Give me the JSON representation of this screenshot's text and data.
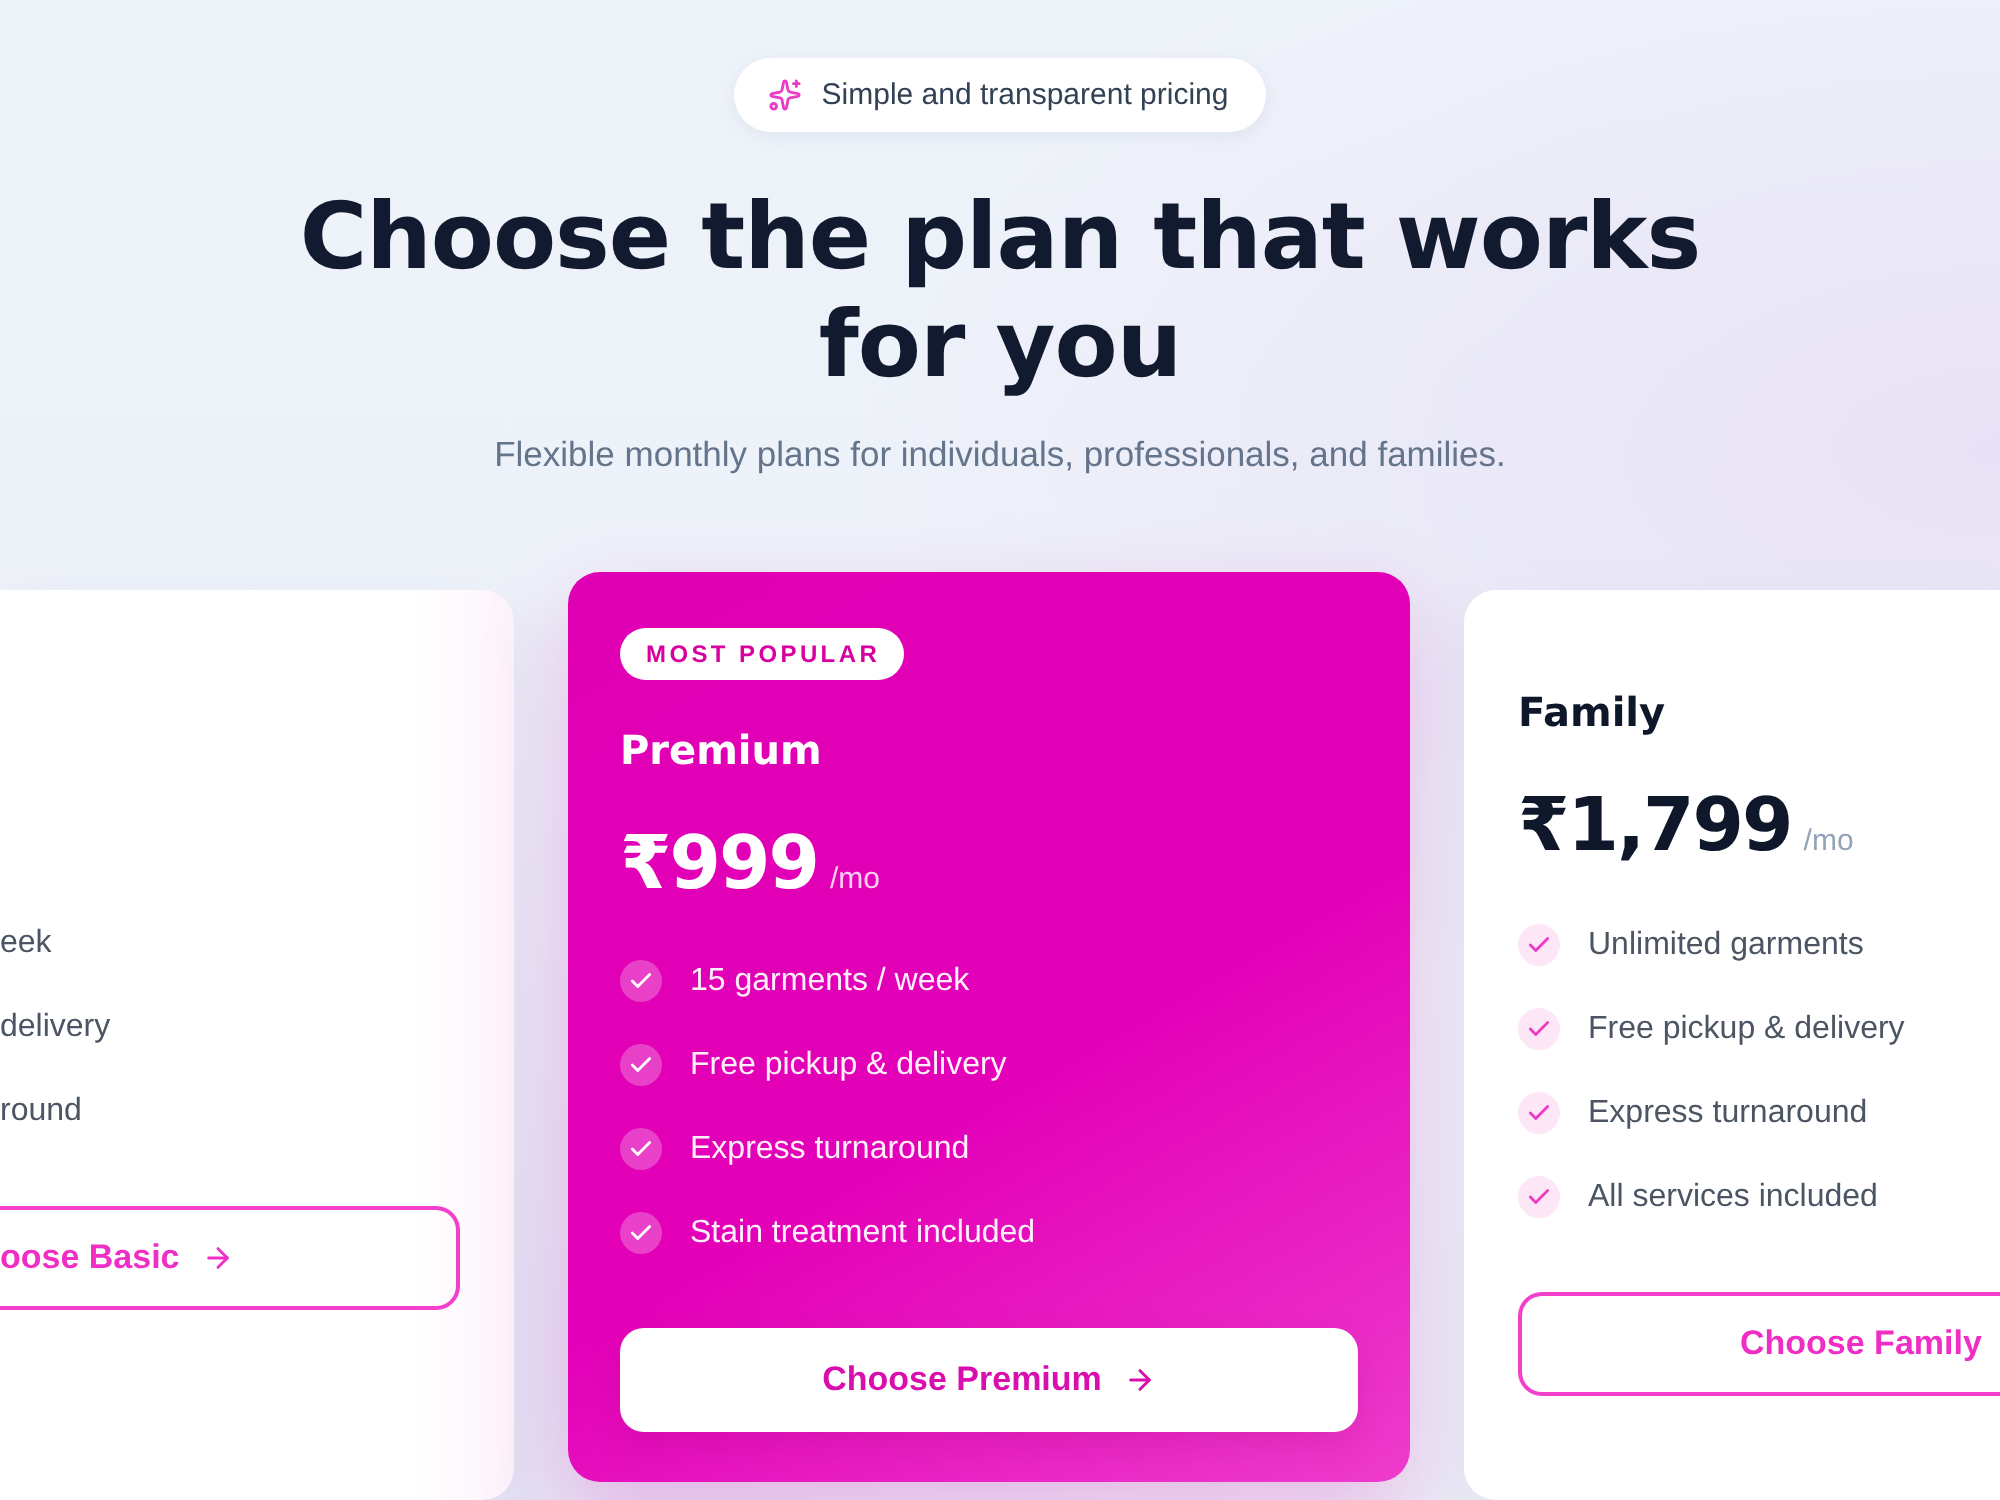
{
  "header": {
    "tagline": "Simple and transparent pricing",
    "title": "Choose the plan that works for you",
    "subtitle": "Flexible monthly plans for individuals, professionals, and families."
  },
  "plans": [
    {
      "highlighted": false,
      "features": [
        "eek",
        "delivery",
        "round"
      ],
      "button": "oose Basic"
    },
    {
      "highlighted": true,
      "badge": "MOST POPULAR",
      "name": "Premium",
      "price": "₹999",
      "period": "/mo",
      "features": [
        "15 garments / week",
        "Free pickup & delivery",
        "Express turnaround",
        "Stain treatment included"
      ],
      "button": "Choose Premium"
    },
    {
      "highlighted": false,
      "name": "Family",
      "price": "₹1,799",
      "period": "/mo",
      "features": [
        "Unlimited garments",
        "Free pickup & delivery",
        "Express turnaround",
        "All services included"
      ],
      "button": "Choose Family"
    }
  ]
}
